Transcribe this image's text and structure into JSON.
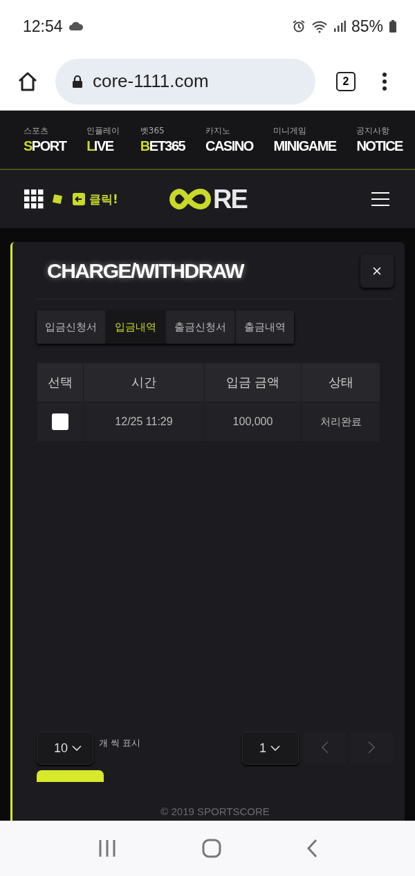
{
  "status_bar": {
    "time": "12:54",
    "battery": "85%"
  },
  "browser": {
    "url": "core-1111.com",
    "tab_count": "2"
  },
  "nav": [
    {
      "ko": "스포츠",
      "en": "**S**PORT"
    },
    {
      "ko": "인플레이",
      "en": "**L**IVE"
    },
    {
      "ko": "벳365",
      "en": "**B**ET365"
    },
    {
      "ko": "카지노",
      "en": "CASINO"
    },
    {
      "ko": "미니게임",
      "en": "MINIGAME"
    },
    {
      "ko": "공지사항",
      "en": "NOTICE"
    }
  ],
  "header": {
    "click_label": "클릭!",
    "logo": "RE"
  },
  "modal": {
    "title": "CHARGE/WITHDRAW",
    "tabs": [
      {
        "label": "입금신청서",
        "selected": false
      },
      {
        "label": "입금내역",
        "selected": true
      },
      {
        "label": "출금신청서",
        "selected": false
      },
      {
        "label": "출금내역",
        "selected": false
      }
    ],
    "table": {
      "columns": [
        "선택",
        "시간",
        "입금 금액",
        "상태"
      ],
      "rows": [
        {
          "checked": false,
          "time": "12/25 11:29",
          "amount": "100,000",
          "status": "처리완료"
        }
      ]
    },
    "page_size": "10",
    "page_size_label": "개 씩 표시",
    "page": "1",
    "copyright": "© 2019 SPORTSCORE"
  }
}
